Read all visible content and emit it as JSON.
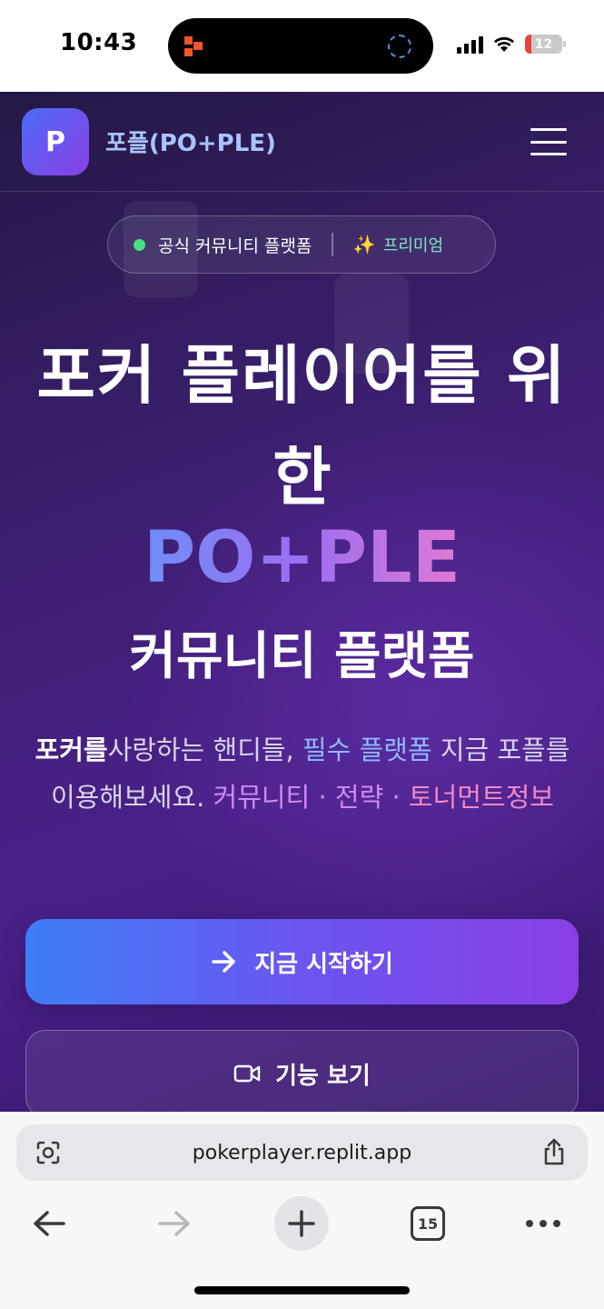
{
  "status_bar": {
    "time": "10:43",
    "battery": "12",
    "battery_level_percent": 12,
    "island_app_icon": "app-logo-icon",
    "island_activity_icon": "loading-ring-icon"
  },
  "site": {
    "logo_letter": "P",
    "brand_name": "포플(PO+PLE)",
    "menu_icon": "hamburger-menu-icon"
  },
  "hero": {
    "pill_official": "공식 커뮤니티 플랫폼",
    "pill_spark": "✨",
    "pill_premium": "프리미엄",
    "title_line1": "포커 플레이어를 위",
    "title_line2": "한",
    "brand_big": "PO+PLE",
    "title_line3": "커뮤니티 플랫폼",
    "desc_bold": "포커를",
    "desc_a": "사랑하는 핸디들, ",
    "desc_blue": "필수 플랫폼",
    "desc_b": " 지금 포플를 이용해보세요. ",
    "desc_purple": "커뮤니티 · 전략 · ",
    "desc_pink": "토너먼트정보"
  },
  "buttons": {
    "start_label": "지금 시작하기",
    "start_icon": "arrow-right-icon",
    "features_label": "기능 보기",
    "features_icon": "video-camera-icon"
  },
  "browser": {
    "url": "pokerplayer.replit.app",
    "tab_count": "15",
    "colors": {
      "accent": "#8b3fe6",
      "primary_blue": "#3f7ef8",
      "bg": "#3b1f6e",
      "status_green": "#4ade80"
    }
  }
}
